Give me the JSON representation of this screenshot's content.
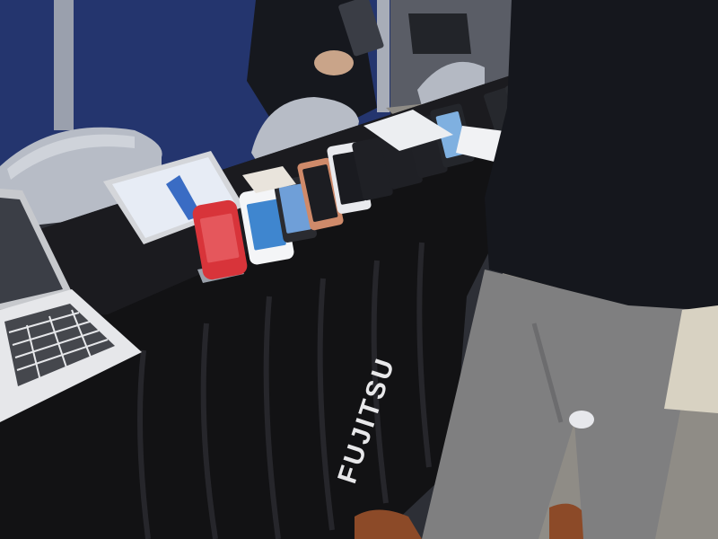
{
  "scene": {
    "description_hidden": "",
    "table_brand_text": "FUJITSU",
    "colors": {
      "wall": "#24356e",
      "floor": "#8f8c86",
      "tablecloth": "#121214",
      "chair": "#b7bcc6",
      "jacket": "#15171d",
      "trousers": "#7f7f80",
      "shoe": "#8c4a28",
      "phone_red": "#d8343a"
    },
    "icons": [
      "laptop-icon",
      "tablet-icon",
      "smartphone-icon",
      "chair-icon",
      "person-icon"
    ]
  }
}
